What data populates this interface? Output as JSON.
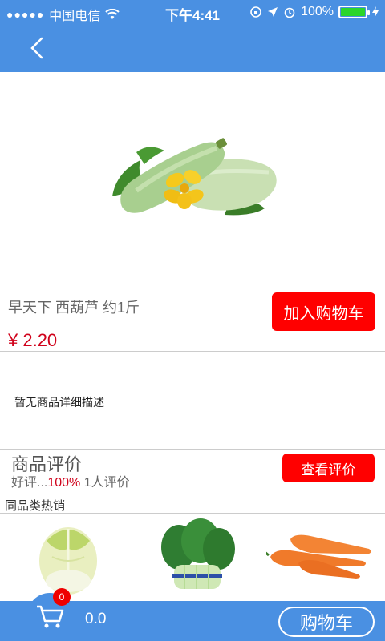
{
  "status_bar": {
    "carrier": "中国电信",
    "time": "下午4:41",
    "battery": "100%"
  },
  "nav": {
    "back_icon": "chevron-left-icon"
  },
  "product": {
    "name": "早天下 西葫芦 约1斤",
    "price": "¥ 2.20",
    "add_to_cart": "加入购物车",
    "description": "暂无商品详细描述"
  },
  "reviews": {
    "title": "商品评价",
    "good_label": "好评...",
    "good_rate": "100%",
    "count_text": "1人评价",
    "view_button": "查看评价"
  },
  "related": {
    "title": "同品类热销",
    "items": [
      {
        "name": "napa-cabbage"
      },
      {
        "name": "bok-choy"
      },
      {
        "name": "carrots"
      }
    ]
  },
  "bottom_bar": {
    "cart_badge": "0",
    "cart_total": "0.0",
    "cart_button": "购物车"
  },
  "colors": {
    "primary": "#4a90e2",
    "accent": "#ff0000",
    "price": "#d0021b"
  }
}
